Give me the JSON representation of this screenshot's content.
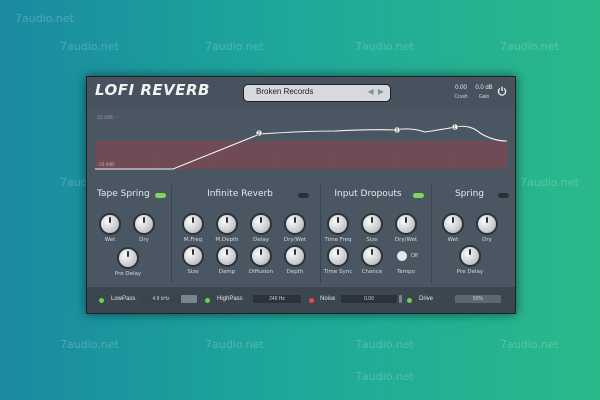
{
  "watermark": "7audio.net",
  "header": {
    "logo": "LOFI REVERB",
    "preset": "Broken Records",
    "preset_arrows": "◀ ▶",
    "crush_value": "0.00",
    "crush_label": "Crush",
    "gain_value": "0.0 dB",
    "gain_label": "Gain"
  },
  "graph": {
    "y_top_label": "15.0dB",
    "y_bottom_label": "-18.4dB",
    "points": [
      "1",
      "2",
      "3"
    ],
    "colors": {
      "fill": "#8a4b57",
      "line": "#f4f4f4",
      "grid": "#5a6570"
    }
  },
  "panels": {
    "tape_spring": {
      "title": "Tape Spring",
      "enabled": true,
      "knobs": [
        "Wet",
        "Dry",
        "Pre Delay"
      ]
    },
    "infinite_reverb": {
      "title": "Infinite Reverb",
      "enabled": false,
      "knobs": [
        "M.Freq",
        "M.Depth",
        "Delay",
        "Dry/Wet",
        "Size",
        "Damp",
        "Diffusion",
        "Depth"
      ]
    },
    "input_dropouts": {
      "title": "Input Dropouts",
      "enabled": true,
      "knobs": [
        "Time Freq",
        "Size",
        "Dry/Wet",
        "Time Sync",
        "Chance"
      ],
      "tempo_label": "Tempo",
      "tempo_state": "Off"
    },
    "spring": {
      "title": "Spring",
      "enabled": false,
      "knobs": [
        "Wet",
        "Dry",
        "Pre Delay"
      ]
    }
  },
  "bottom": {
    "lowpass_label": "LowPass",
    "lowpass_value": "4.9 kHz",
    "highpass_label": "HighPass",
    "highpass_value": "249 Hz",
    "noise_label": "Noise",
    "noise_value": "0.00",
    "drive_label": "Drive",
    "drive_value": "50%"
  },
  "colors": {
    "accent_green": "#7fd65a",
    "led_red": "#e84848",
    "panel_bg": "#4a5662"
  }
}
